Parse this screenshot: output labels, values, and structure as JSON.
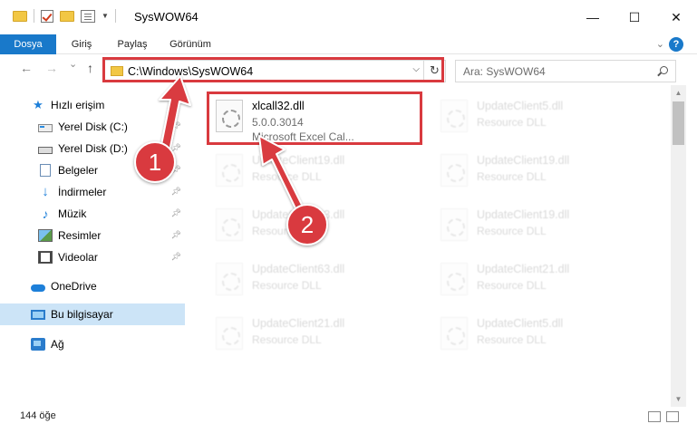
{
  "window": {
    "title": "SysWOW64",
    "minimize": "—",
    "maximize": "☐",
    "close": "✕"
  },
  "ribbon": {
    "tabs": [
      {
        "label": "Dosya",
        "active": true
      },
      {
        "label": "Giriş",
        "active": false
      },
      {
        "label": "Paylaş",
        "active": false
      },
      {
        "label": "Görünüm",
        "active": false
      }
    ],
    "help": "?"
  },
  "navigation": {
    "back": "←",
    "forward": "→",
    "recent": "⌄",
    "up": "↑",
    "address": "C:\\Windows\\SysWOW64",
    "refresh": "↻",
    "search_placeholder": "Ara: SysWOW64"
  },
  "sidebar": {
    "items": [
      {
        "label": "Hızlı erişim",
        "icon": "star-icon"
      },
      {
        "label": "Yerel Disk (C:)",
        "icon": "drive-icon",
        "pinned": true
      },
      {
        "label": "Yerel Disk (D:)",
        "icon": "drive-icon",
        "pinned": true
      },
      {
        "label": "Belgeler",
        "icon": "documents-icon",
        "pinned": true
      },
      {
        "label": "İndirmeler",
        "icon": "download-icon",
        "pinned": true
      },
      {
        "label": "Müzik",
        "icon": "music-icon",
        "pinned": true
      },
      {
        "label": "Resimler",
        "icon": "pictures-icon",
        "pinned": true
      },
      {
        "label": "Videolar",
        "icon": "videos-icon",
        "pinned": true
      },
      {
        "label": "OneDrive",
        "icon": "cloud-icon"
      },
      {
        "label": "Bu bilgisayar",
        "icon": "computer-icon",
        "selected": true
      },
      {
        "label": "Ağ",
        "icon": "network-icon"
      }
    ]
  },
  "files": [
    {
      "name": "xlcall32.dll",
      "line2": "5.0.0.3014",
      "line3": "Microsoft Excel Cal...",
      "highlighted": true
    },
    {
      "name": "UpdateClient5.dll",
      "line2": "Resource DLL"
    },
    {
      "name": "UpdateClient19.dll",
      "line2": "Resource DLL"
    },
    {
      "name": "UpdateClient19.dll",
      "line2": "Resource DLL"
    },
    {
      "name": "UpdateClient63.dll",
      "line2": "Resource DLL"
    },
    {
      "name": "UpdateClient19.dll",
      "line2": "Resource DLL"
    },
    {
      "name": "UpdateClient63.dll",
      "line2": "Resource DLL"
    },
    {
      "name": "UpdateClient21.dll",
      "line2": "Resource DLL"
    },
    {
      "name": "UpdateClient21.dll",
      "line2": "Resource DLL"
    },
    {
      "name": "UpdateClient5.dll",
      "line2": "Resource DLL"
    }
  ],
  "status": {
    "item_count": "144 öğe"
  },
  "callouts": {
    "one": "1",
    "two": "2"
  },
  "colors": {
    "accent": "#1979ca",
    "highlight_red": "#d93a3f",
    "selection": "#cce4f7"
  }
}
